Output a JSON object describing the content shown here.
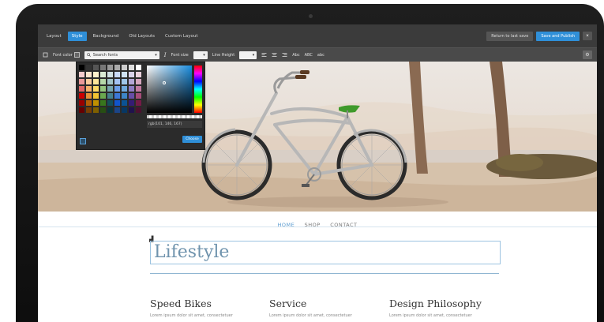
{
  "toolbar": {
    "tabs": [
      {
        "label": "Layout"
      },
      {
        "label": "Style"
      },
      {
        "label": "Background"
      },
      {
        "label": "Old Layouts"
      },
      {
        "label": "Custom Layout"
      }
    ],
    "revert_label": "Return to last save",
    "save_publish_label": "Save and Publish",
    "close_label": "×"
  },
  "format_bar": {
    "font_label": "Font color",
    "search_fonts_placeholder": "Search fonts",
    "italic_label": "I",
    "font_size_label": "Font size",
    "line_height_label": "Line Height",
    "case_buttons": [
      "Abc",
      "ABC",
      "abc"
    ]
  },
  "color_picker": {
    "rgb_value": "rgb(101, 146, 167)",
    "choose_label": "Choose",
    "swatch_colors": [
      "#000000",
      "#333333",
      "#555555",
      "#777777",
      "#999999",
      "#aaaaaa",
      "#cccccc",
      "#dddddd",
      "#ffffff",
      "#f4cccc",
      "#fce5cd",
      "#fff2cc",
      "#d9ead3",
      "#d0e0e3",
      "#c9daf8",
      "#cfe2f3",
      "#d9d2e9",
      "#ead1dc",
      "#ea9999",
      "#f9cb9c",
      "#ffe599",
      "#b6d7a8",
      "#a2c4c9",
      "#a4c2f4",
      "#9fc5e8",
      "#b4a7d6",
      "#d5a6bd",
      "#e06666",
      "#f6b26b",
      "#ffd966",
      "#93c47d",
      "#76a5af",
      "#6d9eeb",
      "#6fa8dc",
      "#8e7cc3",
      "#c27ba0",
      "#cc0000",
      "#e69138",
      "#f1c232",
      "#6aa84f",
      "#45818e",
      "#3c78d8",
      "#3d85c6",
      "#674ea7",
      "#a64d79",
      "#990000",
      "#b45f06",
      "#bf9000",
      "#38761d",
      "#134f5c",
      "#1155cc",
      "#0b5394",
      "#351c75",
      "#741b47",
      "#660000",
      "#783f04",
      "#7f6000",
      "#274e13",
      "#0c343d",
      "#1c4587",
      "#073763",
      "#20124d",
      "#4c1130"
    ]
  },
  "site": {
    "nav": [
      "HOME",
      "SHOP",
      "CONTACT"
    ],
    "page_title": "Lifestyle",
    "columns": [
      {
        "heading": "Speed Bikes",
        "text": "Lorem ipsum dolor sit amet, consectetuer"
      },
      {
        "heading": "Service",
        "text": "Lorem ipsum dolor sit amet, consectetuer"
      },
      {
        "heading": "Design Philosophy",
        "text": "Lorem ipsum dolor sit amet, consectetuer"
      }
    ]
  },
  "colors": {
    "accent": "#2f8fd8",
    "toolbar_bg": "#3b3b3b",
    "title_color": "#6f93ad"
  }
}
